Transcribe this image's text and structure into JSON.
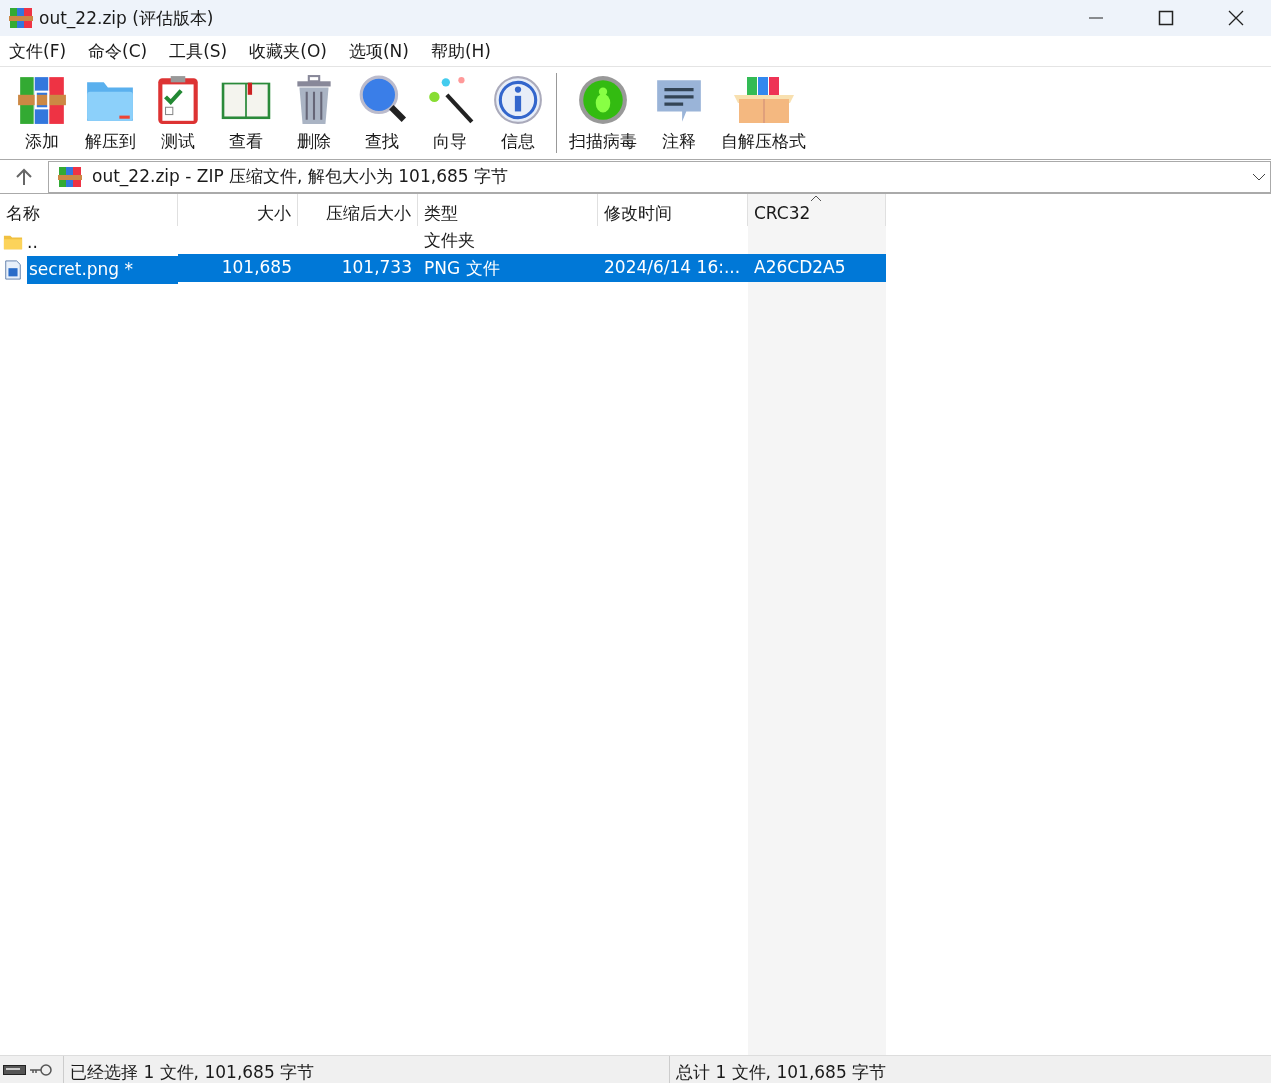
{
  "window": {
    "title": "out_22.zip (评估版本)"
  },
  "menu": [
    "文件(F)",
    "命令(C)",
    "工具(S)",
    "收藏夹(O)",
    "选项(N)",
    "帮助(H)"
  ],
  "toolbar": [
    {
      "kind": "add",
      "label": "添加"
    },
    {
      "kind": "extract",
      "label": "解压到"
    },
    {
      "kind": "test",
      "label": "测试"
    },
    {
      "kind": "view",
      "label": "查看"
    },
    {
      "kind": "delete",
      "label": "删除"
    },
    {
      "kind": "find",
      "label": "查找"
    },
    {
      "kind": "wizard",
      "label": "向导"
    },
    {
      "kind": "info",
      "label": "信息"
    },
    {
      "kind": "scan",
      "label": "扫描病毒"
    },
    {
      "kind": "comment",
      "label": "注释"
    },
    {
      "kind": "sfx",
      "label": "自解压格式"
    }
  ],
  "address": {
    "text": "out_22.zip - ZIP 压缩文件, 解包大小为 101,685 字节"
  },
  "table": {
    "columns": [
      {
        "label": "名称",
        "sorted": false
      },
      {
        "label": "大小",
        "sorted": false
      },
      {
        "label": "压缩后大小",
        "sorted": false
      },
      {
        "label": "类型",
        "sorted": false
      },
      {
        "label": "修改时间",
        "sorted": false
      },
      {
        "label": "CRC32",
        "sorted": true
      }
    ],
    "rows": [
      {
        "kind": "folder",
        "selected": false,
        "cells": [
          "..",
          "",
          "",
          "文件夹",
          "",
          ""
        ]
      },
      {
        "kind": "image",
        "selected": true,
        "cells": [
          "secret.png *",
          "101,685",
          "101,733",
          "PNG 文件",
          "2024/6/14 16:...",
          "A26CD2A5"
        ]
      }
    ]
  },
  "status_bar": {
    "left": "已经选择 1 文件, 101,685 字节",
    "right": "总计 1 文件, 101,685 字节"
  }
}
